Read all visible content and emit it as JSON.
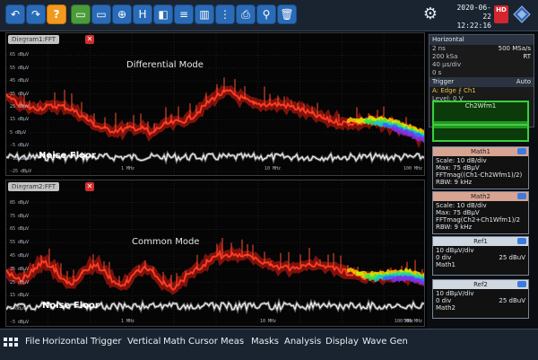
{
  "toolbar": {
    "buttons": [
      {
        "name": "undo-button",
        "glyph": "↶",
        "style": "blue"
      },
      {
        "name": "redo-button",
        "glyph": "↷",
        "style": "blue"
      },
      {
        "name": "help-button",
        "glyph": "?",
        "style": "orange"
      },
      {
        "name": "open-file-button",
        "glyph": "▭",
        "style": "green"
      },
      {
        "name": "save-file-button",
        "glyph": "▭",
        "style": "blue"
      },
      {
        "name": "zoom-button",
        "glyph": "⊕",
        "style": "blue"
      },
      {
        "name": "hist-button",
        "glyph": "H",
        "style": "blue"
      },
      {
        "name": "screen-button",
        "glyph": "◧",
        "style": "blue"
      },
      {
        "name": "mask-button",
        "glyph": "≡",
        "style": "blue"
      },
      {
        "name": "meas-button",
        "glyph": "▥",
        "style": "blue"
      },
      {
        "name": "ref-button",
        "glyph": "⋮",
        "style": "blue"
      },
      {
        "name": "print-button",
        "glyph": "⎙",
        "style": "blue"
      },
      {
        "name": "usb-button",
        "glyph": "⚲",
        "style": "blue"
      },
      {
        "name": "delete-button",
        "glyph": "🗑",
        "style": "blue"
      }
    ],
    "date": "2020-06-22",
    "time": "12:22:16",
    "hd_label": "HD"
  },
  "diagram1": {
    "tab": "Diagram1:FFT",
    "title": "Differential Mode",
    "noise_label": "Noise Floor",
    "ylabels": [
      "75 dBµV",
      "65 dBµV",
      "55 dBµV",
      "45 dBµV",
      "35 dBµV",
      "25 dBµV",
      "15 dBµV",
      "5 dBµV",
      "-5 dBµV",
      "-15 dBµV",
      "-25 dBµV"
    ],
    "xlabels": [
      "1 MHz",
      "10 MHz",
      "100 MHz"
    ]
  },
  "diagram2": {
    "tab": "Diagram2:FFT",
    "title": "Common Mode",
    "noise_label": "Noise Floor",
    "ylabels": [
      "95 dBµV",
      "85 dBµV",
      "75 dBµV",
      "65 dBµV",
      "55 dBµV",
      "45 dBµV",
      "35 dBµV",
      "25 dBµV",
      "15 dBµV",
      "5 dBµV",
      "-5 dBµV"
    ],
    "xlabels": [
      "1 MHz",
      "10 MHz",
      "100 MHz",
      "500 MHz"
    ]
  },
  "sidebar": {
    "horizontal": {
      "title": "Horizontal",
      "rows": [
        {
          "l": "2 ns",
          "r": "500 MSa/s"
        },
        {
          "l": "200 kSa",
          "r": "RT"
        },
        {
          "l": "40 µs/div",
          "r": ""
        },
        {
          "l": "0 s",
          "r": ""
        }
      ],
      "trigger_title": "Trigger",
      "trigger_mode": "Auto",
      "trigger_line": "A:    Edge  ⨍  Ch1",
      "level": "Level: 0 V"
    },
    "waveform_label": "Ch2Wfm1",
    "math1": {
      "title": "Math1",
      "lines": [
        "Scale: 10 dB/div",
        "Max:  75 dBµV",
        "FFTmag((Ch1-Ch2Wfm1)/2)",
        "RBW: 9 kHz"
      ]
    },
    "math2": {
      "title": "Math2",
      "lines": [
        "Scale: 10 dB/div",
        "Max:  75 dBµV",
        "FFTmag(Ch2+Ch1Wfm1)/2",
        "RBW: 9 kHz"
      ]
    },
    "ref1": {
      "title": "Ref1",
      "line1": "10 dBµV/div",
      "line2": "0 div",
      "line2r": "25 dBuV",
      "line3": "Math1"
    },
    "ref2": {
      "title": "Ref2",
      "line1": "10 dBµV/div",
      "line2": "0 div",
      "line2r": "25 dBuV",
      "line3": "Math2"
    }
  },
  "menubar": {
    "items": [
      "File",
      "Horizontal",
      "Trigger",
      "Vertical",
      "Math",
      "Cursor",
      "Meas",
      "Masks",
      "Analysis",
      "Display",
      "Wave Gen"
    ]
  },
  "colors": {
    "accent": "#2a6bb8",
    "trace_red": "#e0281c",
    "math_header": "#d8a492",
    "ref_header": "#cfd7e0"
  }
}
